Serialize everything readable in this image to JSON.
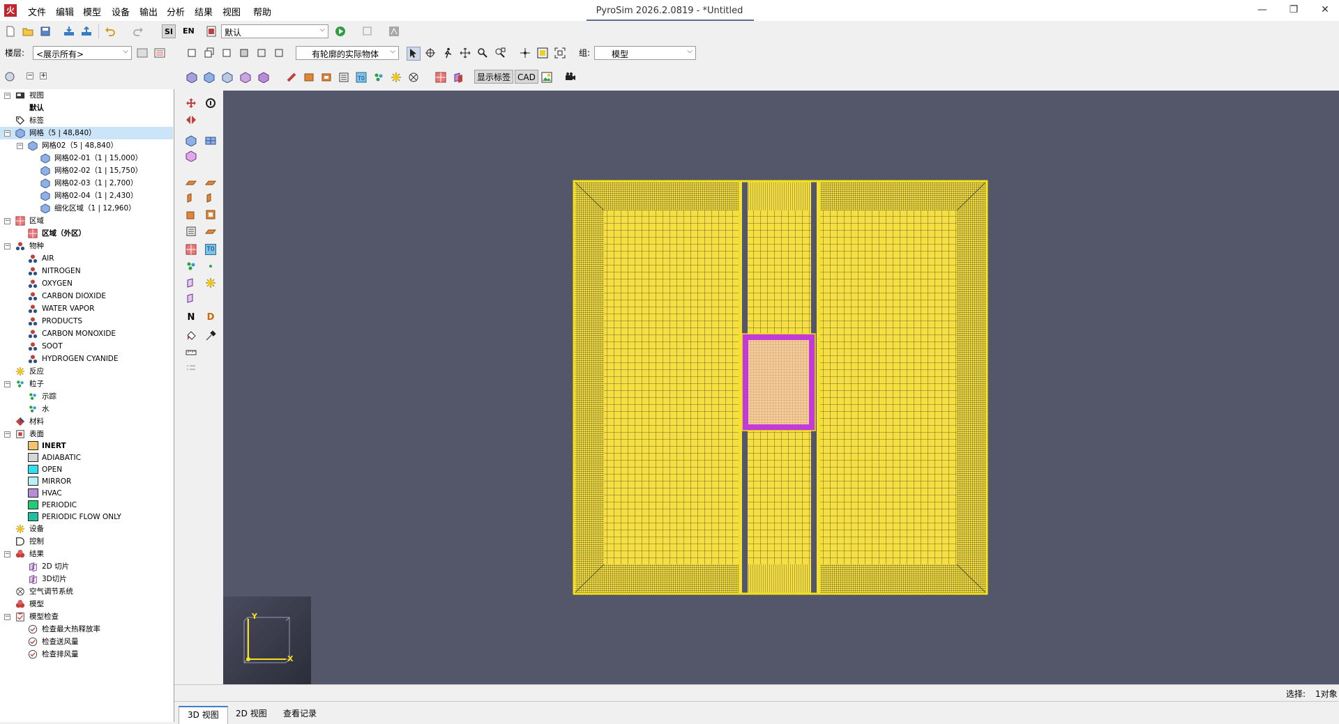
{
  "window": {
    "title": "PyroSim 2026.2.0819 - *Untitled",
    "app_logo": "火",
    "minimize": "—",
    "maximize": "❐",
    "close": "✕"
  },
  "menu": [
    "文件",
    "编辑",
    "模型",
    "设备",
    "输出",
    "分析",
    "结果",
    "视图",
    "帮助"
  ],
  "toolbar1": {
    "unit_si": "SI",
    "unit_en": "EN",
    "view_select": "默认"
  },
  "toolbar2": {
    "floor_label": "楼层:",
    "floor_select": "<展示所有>",
    "render_select": "有轮廓的实际物体",
    "group_label": "组:",
    "group_select": "模型"
  },
  "toolbar3": {
    "show_labels": "显示标签",
    "cad": "CAD"
  },
  "side_toolbar": {
    "n_label": "N",
    "d_label": "D",
    "t0_label": "T0"
  },
  "tree": {
    "view": "视图",
    "default": "默认",
    "labels": "标签",
    "mesh_root": "网格（5 | 48,840）",
    "mesh_group": "网格02（5 | 48,840）",
    "meshes": [
      "网格02-01（1 | 15,000）",
      "网格02-02（1 | 15,750）",
      "网格02-03（1 | 2,700）",
      "网格02-04（1 | 2,430）",
      "细化区域（1 | 12,960）"
    ],
    "zones": "区域",
    "zone_outer": "区域（外区）",
    "species": "物种",
    "species_items": [
      "AIR",
      "NITROGEN",
      "OXYGEN",
      "CARBON DIOXIDE",
      "WATER VAPOR",
      "PRODUCTS",
      "CARBON MONOXIDE",
      "SOOT",
      "HYDROGEN CYANIDE"
    ],
    "reactions": "反应",
    "particles": "粒子",
    "particle_items": [
      "示踪",
      "水"
    ],
    "materials": "材料",
    "surfaces": "表面",
    "surface_items": [
      {
        "name": "INERT",
        "color": "#f3c46b"
      },
      {
        "name": "ADIABATIC",
        "color": "#d6d6d6"
      },
      {
        "name": "OPEN",
        "color": "#33ddee"
      },
      {
        "name": "MIRROR",
        "color": "#b8f0f5"
      },
      {
        "name": "HVAC",
        "color": "#b48ed6"
      },
      {
        "name": "PERIODIC",
        "color": "#22cc77"
      },
      {
        "name": "PERIODIC FLOW ONLY",
        "color": "#1fbfa0"
      }
    ],
    "devices": "设备",
    "controls": "控制",
    "results": "结果",
    "result_items": [
      "2D 切片",
      "3D切片"
    ],
    "hvac": "空气调节系统",
    "model": "模型",
    "model_check": "模型检查",
    "check_items": [
      "检查最大热释放率",
      "检查送风量",
      "检查排风量"
    ]
  },
  "viewport": {
    "background": "#545669",
    "mesh_color": "#f5df43",
    "refine_color": "#c23ad8",
    "axis_y": "Y",
    "axis_x": "X"
  },
  "status": {
    "selection_label": "选择:",
    "selection_value": "1对象"
  },
  "tabs": [
    "3D 视图",
    "2D 视图",
    "查看记录"
  ]
}
